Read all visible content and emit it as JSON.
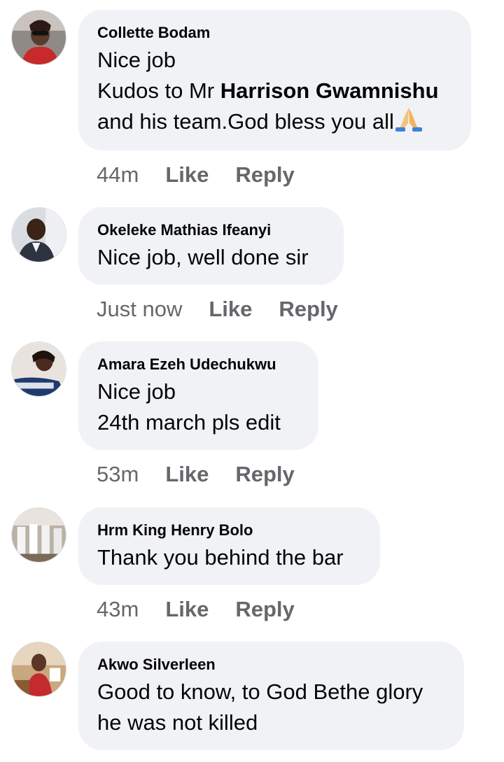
{
  "comments": [
    {
      "author": "Collette Bodam",
      "lines": [
        "Nice job",
        "Kudos to Mr ",
        "Harrison Gwamnishu",
        "and his team.God bless you all"
      ],
      "emoji": "folded-hands-icon",
      "time": "44m",
      "like_label": "Like",
      "reply_label": "Reply"
    },
    {
      "author": "Okeleke Mathias Ifeanyi",
      "lines": [
        "Nice job, well done sir"
      ],
      "time": "Just now",
      "like_label": "Like",
      "reply_label": "Reply"
    },
    {
      "author": "Amara Ezeh Udechukwu",
      "lines": [
        "Nice job",
        "24th march pls edit"
      ],
      "time": "53m",
      "like_label": "Like",
      "reply_label": "Reply"
    },
    {
      "author": "Hrm King Henry Bolo",
      "lines": [
        "Thank you behind the bar"
      ],
      "time": "43m",
      "like_label": "Like",
      "reply_label": "Reply"
    },
    {
      "author": "Akwo Silverleen",
      "lines": [
        "Good to know, to God Bethe glory",
        "he was not killed"
      ]
    }
  ],
  "colors": {
    "bubble": "#f0f2f5",
    "meta_text": "#65676b",
    "text": "#050505"
  }
}
